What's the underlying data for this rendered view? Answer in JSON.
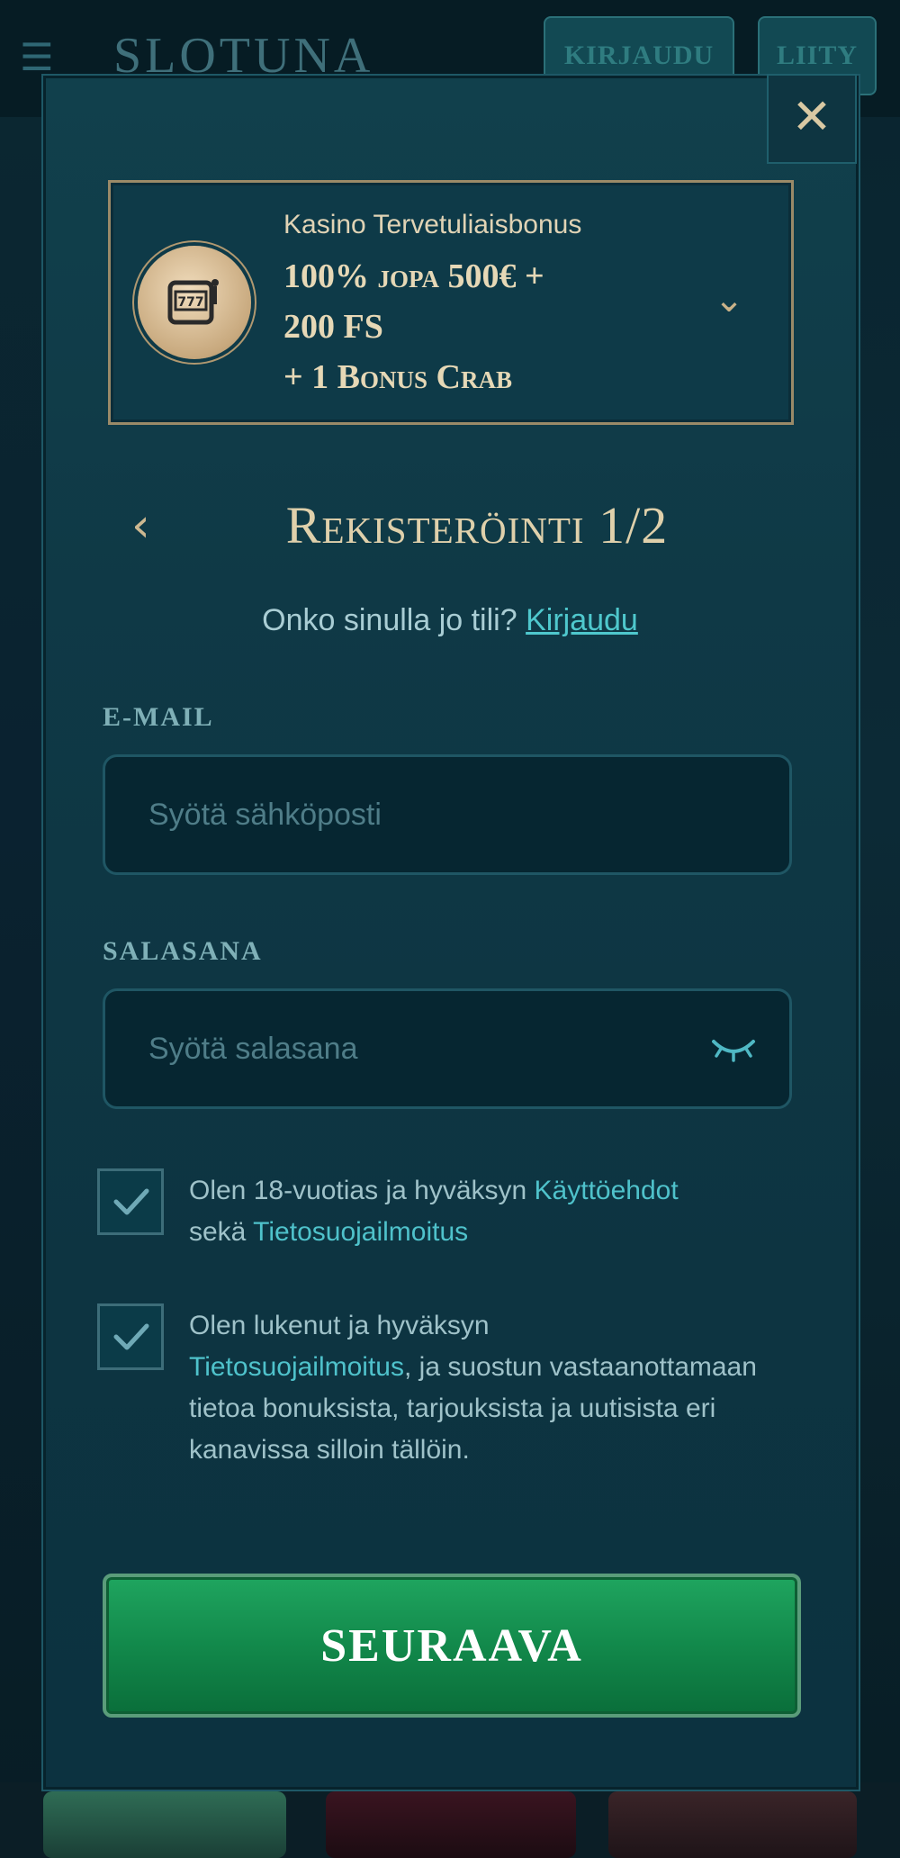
{
  "header": {
    "logo_text": "SLOTUNA",
    "login_label": "KIRJAUDU",
    "join_label": "LIITY"
  },
  "bonus": {
    "title": "Kasino Tervetuliaisbonus",
    "offer_line1": "100% jopa 500€ +",
    "offer_line2": "200 FS",
    "offer_line3": "+ 1 Bonus Crab"
  },
  "registration": {
    "title": "Rekisteröinti 1/2",
    "account_question": "Onko sinulla jo tili?",
    "login_link": "Kirjaudu"
  },
  "email": {
    "label": "E-MAIL",
    "placeholder": "Syötä sähköposti"
  },
  "password": {
    "label": "SALASANA",
    "placeholder": "Syötä salasana"
  },
  "terms": {
    "checked": true,
    "text1": "Olen 18-vuotias ja hyväksyn",
    "link1": "Käyttöehdot",
    "text2": "sekä",
    "link2": "Tietosuojailmoitus"
  },
  "marketing": {
    "checked": true,
    "text1": "Olen lukenut ja hyväksyn",
    "link1": "Tietosuojailmoitus",
    "text2": ", ja suostun vastaanottamaan tietoa bonuksista, tarjouksista ja uutisista eri kanavissa silloin tällöin."
  },
  "next_label": "SEURAAVA",
  "colors": {
    "accent_gold": "#dfd0ab",
    "link_teal": "#4fc8cd",
    "button_green": "#12894b",
    "modal_bg": "#0f3946"
  }
}
